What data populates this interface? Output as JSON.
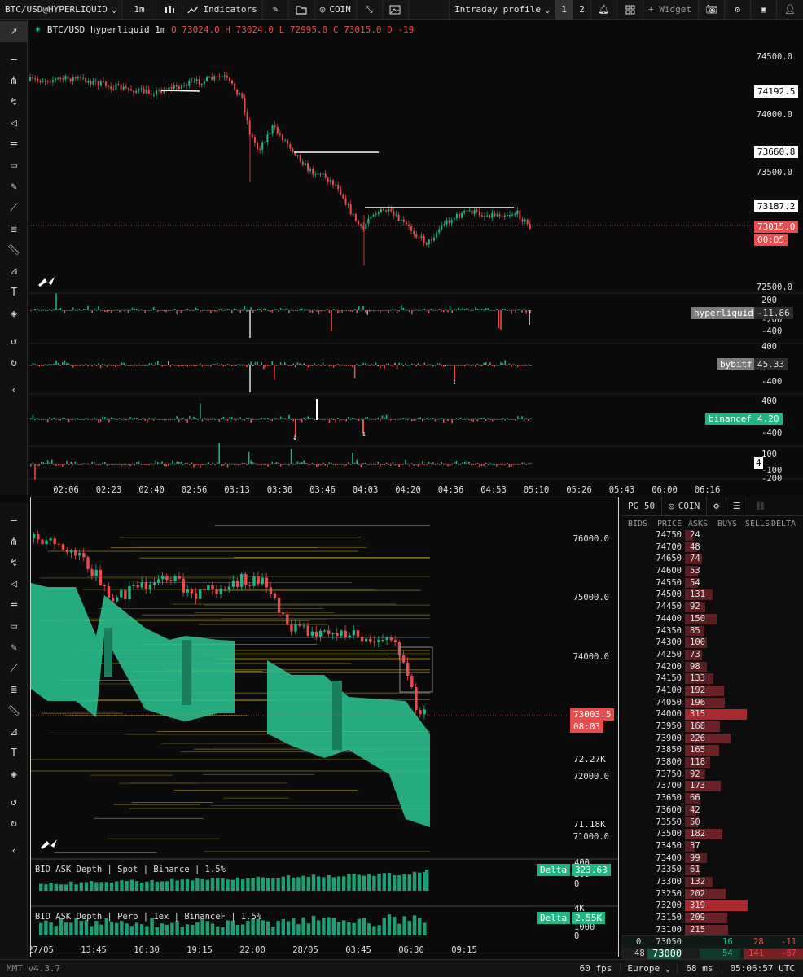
{
  "topbar": {
    "symbol": "BTC/USD@HYPERLIQUID",
    "interval": "1m",
    "indicators": "Indicators",
    "coin": "COIN",
    "profile": "Intraday profile",
    "layout1": "1",
    "layout2": "2",
    "widget": "+ Widget"
  },
  "chart1": {
    "title": "BTC/USD hyperliquid 1m",
    "o": "O 73024.0",
    "h": "H 73024.0",
    "l": "L 72995.0",
    "c": "C 73015.0",
    "d": "D -19",
    "price_ticks": [
      "74500.0",
      "74000.0",
      "73500.0",
      "73000.0",
      "72500.0"
    ],
    "line_labels": [
      "74192.5",
      "73660.8",
      "73187.2"
    ],
    "last_price": "73015.0",
    "countdown": "00:05",
    "time_ticks": [
      "02:06",
      "02:23",
      "02:40",
      "02:56",
      "03:13",
      "03:30",
      "03:46",
      "04:03",
      "04:20",
      "04:36",
      "04:53",
      "05:10",
      "05:26",
      "05:43",
      "06:00",
      "06:16"
    ]
  },
  "sub_panes": [
    {
      "name": "hyperliquid",
      "value": "-11.86",
      "ticks": [
        "200",
        "-200",
        "-400"
      ]
    },
    {
      "name": "bybitf",
      "value": "45.33",
      "ticks": [
        "400",
        "-400"
      ]
    },
    {
      "name": "binancef",
      "value": "4.20",
      "ticks": [
        "400",
        "-400"
      ]
    },
    {
      "name": "",
      "value": "4",
      "ticks": [
        "100",
        "-100",
        "-200"
      ]
    }
  ],
  "chart2": {
    "price_ticks": [
      "76000.0",
      "75000.0",
      "74000.0",
      "72000.0",
      "71000.0"
    ],
    "last_price": "73003.5",
    "countdown": "08:03",
    "vol_labels": [
      "72.27K",
      "71.18K"
    ],
    "time_ticks": [
      "27/05",
      "13:45",
      "16:30",
      "19:15",
      "22:00",
      "28/05",
      "03:45",
      "06:30",
      "09:15"
    ],
    "depth1": {
      "title": "BID ASK Depth | Spot | Binance | 1.5%",
      "delta_label": "Delta",
      "delta": "323.63",
      "ticks": [
        "400",
        "200",
        "0"
      ]
    },
    "depth2": {
      "title": "BID ASK Depth | Perp | 1ex | BinanceF | 1.5%",
      "delta_label": "Delta",
      "delta": "2.55K",
      "ticks": [
        "4K",
        "2000",
        "1000",
        "0"
      ]
    }
  },
  "orderbook": {
    "grouping": "PG 50",
    "coin": "COIN",
    "columns": [
      "BIDS",
      "PRICE",
      "ASKS",
      "BUYS",
      "SELLS",
      "DELTA"
    ],
    "rows": [
      {
        "price": "74750",
        "ask": "24"
      },
      {
        "price": "74700",
        "ask": "48"
      },
      {
        "price": "74650",
        "ask": "74"
      },
      {
        "price": "74600",
        "ask": "53"
      },
      {
        "price": "74550",
        "ask": "54"
      },
      {
        "price": "74500",
        "ask": "131"
      },
      {
        "price": "74450",
        "ask": "92"
      },
      {
        "price": "74400",
        "ask": "150"
      },
      {
        "price": "74350",
        "ask": "85"
      },
      {
        "price": "74300",
        "ask": "100"
      },
      {
        "price": "74250",
        "ask": "73"
      },
      {
        "price": "74200",
        "ask": "98"
      },
      {
        "price": "74150",
        "ask": "133"
      },
      {
        "price": "74100",
        "ask": "192"
      },
      {
        "price": "74050",
        "ask": "196"
      },
      {
        "price": "74000",
        "ask": "315"
      },
      {
        "price": "73950",
        "ask": "168"
      },
      {
        "price": "73900",
        "ask": "226"
      },
      {
        "price": "73850",
        "ask": "165"
      },
      {
        "price": "73800",
        "ask": "118"
      },
      {
        "price": "73750",
        "ask": "92"
      },
      {
        "price": "73700",
        "ask": "173"
      },
      {
        "price": "73650",
        "ask": "66"
      },
      {
        "price": "73600",
        "ask": "42"
      },
      {
        "price": "73550",
        "ask": "50"
      },
      {
        "price": "73500",
        "ask": "182"
      },
      {
        "price": "73450",
        "ask": "37"
      },
      {
        "price": "73400",
        "ask": "99"
      },
      {
        "price": "73350",
        "ask": "61"
      },
      {
        "price": "73300",
        "ask": "132"
      },
      {
        "price": "73250",
        "ask": "202"
      },
      {
        "price": "73200",
        "ask": "319"
      },
      {
        "price": "73150",
        "ask": "209"
      },
      {
        "price": "73100",
        "ask": "215"
      }
    ],
    "row_73050": {
      "bid": "0",
      "price": "73050",
      "buys": "16",
      "sells": "28",
      "delta": "-11"
    },
    "row_73000": {
      "bid": "48",
      "price": "73000",
      "buys": "54",
      "sells": "141",
      "delta": "-87"
    }
  },
  "status": {
    "version": "MMT v4.3.7",
    "fps": "60 fps",
    "region": "Europe",
    "latency": "68 ms",
    "clock": "05:06:57 UTC"
  },
  "colors": {
    "up": "#21b582",
    "down": "#e84c4c",
    "bg": "#0b0b0b"
  }
}
